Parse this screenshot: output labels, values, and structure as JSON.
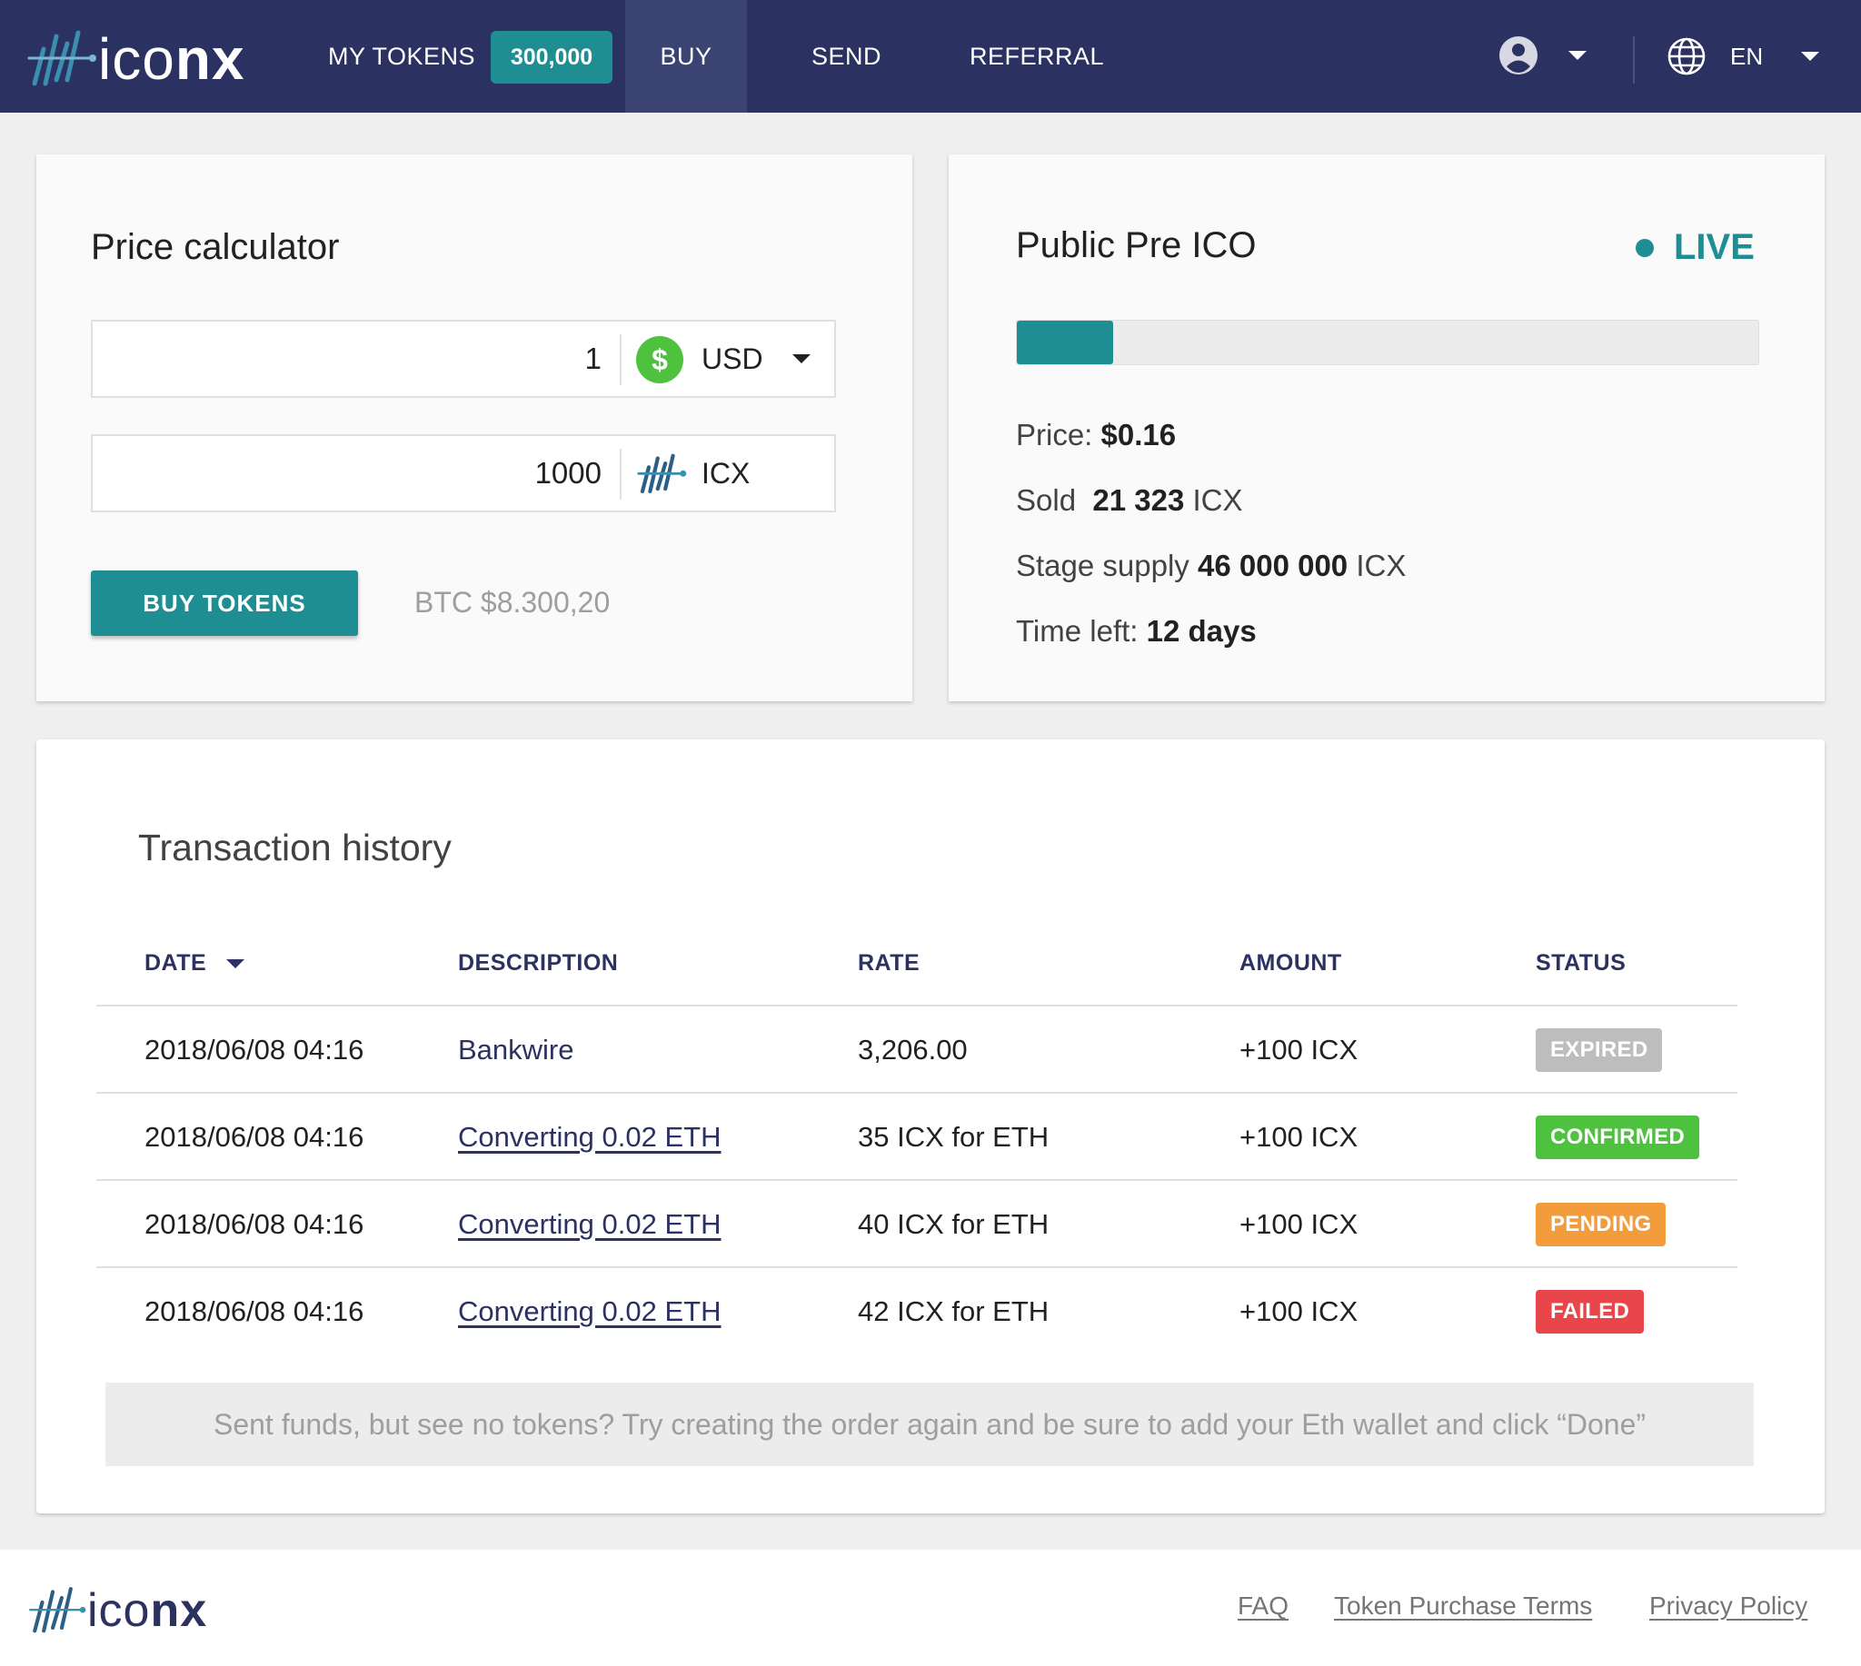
{
  "brand": {
    "name_light": "ico",
    "name_bold": "nx"
  },
  "nav": {
    "my_tokens_label": "MY TOKENS",
    "token_balance": "300,000",
    "buy_label": "BUY",
    "send_label": "SEND",
    "referral_label": "REFERRAL",
    "language": "EN",
    "active": "BUY"
  },
  "calculator": {
    "title": "Price calculator",
    "from_amount": "1",
    "from_currency": "USD",
    "from_icon": "dollar-coin-icon",
    "to_amount": "1000",
    "to_currency": "ICX",
    "to_icon": "icx-logo-icon",
    "buy_button": "BUY TOKENS",
    "btc_rate": "BTC $8.300,20"
  },
  "ico": {
    "title": "Public Pre ICO",
    "status": "LIVE",
    "progress_fraction": 0.13,
    "price_label": "Price:",
    "price_value": "$0.16",
    "sold_label": "Sold",
    "sold_value": "21 323",
    "sold_unit": "ICX",
    "supply_label": "Stage supply",
    "supply_value": "46 000 000",
    "supply_unit": "ICX",
    "time_label": "Time left:",
    "time_value": "12 days"
  },
  "history": {
    "title": "Transaction history",
    "columns": {
      "date": "DATE",
      "description": "DESCRIPTION",
      "rate": "RATE",
      "amount": "AMOUNT",
      "status": "STATUS"
    },
    "rows": [
      {
        "date": "2018/06/08 04:16",
        "description": "Bankwire",
        "rate": "3,206.00",
        "amount": "+100 ICX",
        "status": "EXPIRED"
      },
      {
        "date": "2018/06/08 04:16",
        "description": "Converting 0.02 ETH",
        "rate": "35 ICX for ETH",
        "amount": "+100 ICX",
        "status": "CONFIRMED"
      },
      {
        "date": "2018/06/08 04:16",
        "description": "Converting 0.02 ETH",
        "rate": "40 ICX for ETH",
        "amount": "+100 ICX",
        "status": "PENDING"
      },
      {
        "date": "2018/06/08 04:16",
        "description": "Converting 0.02 ETH",
        "rate": "42 ICX for ETH",
        "amount": "+100 ICX",
        "status": "FAILED"
      }
    ],
    "note": "Sent funds, but see no tokens? Try creating the order again and be sure to add your Eth wallet and click “Done”"
  },
  "footer": {
    "faq": "FAQ",
    "terms": "Token Purchase Terms",
    "privacy": "Privacy Policy"
  },
  "colors": {
    "nav_bg": "#2b3261",
    "accent": "#1e8e93",
    "expired": "#bdbdbd",
    "confirmed": "#4ec13f",
    "pending": "#f39c3c",
    "failed": "#e8464a"
  }
}
